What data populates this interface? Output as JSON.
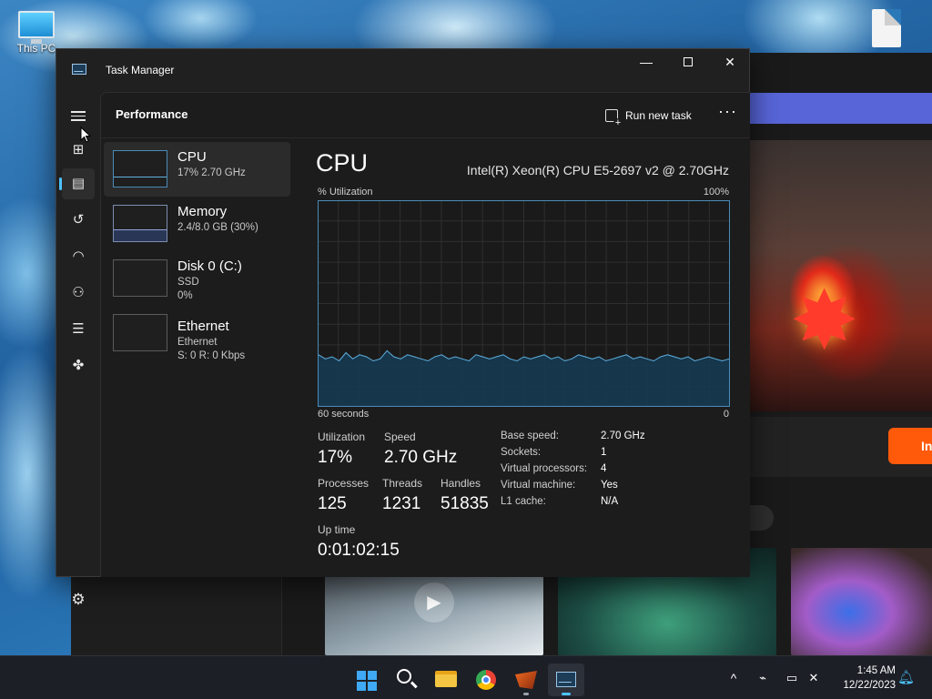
{
  "desktop": {
    "icons": [
      {
        "label": "This PC"
      }
    ]
  },
  "background_app": {
    "button_label_partial": "In",
    "pill_label_partial": "s"
  },
  "window": {
    "title": "Task Manager",
    "controls": {
      "minimize": "—",
      "close": "✕"
    }
  },
  "nav": {
    "items": [
      "Processes",
      "Performance",
      "App history",
      "Startup apps",
      "Users",
      "Details",
      "Services"
    ],
    "active": "Performance",
    "settings_label": "Settings"
  },
  "header": {
    "title": "Performance",
    "run_new_task": "Run new task",
    "more": "···"
  },
  "devices": [
    {
      "name": "CPU",
      "line1": "17%  2.70 GHz",
      "line2": ""
    },
    {
      "name": "Memory",
      "line1": "2.4/8.0 GB (30%)",
      "line2": ""
    },
    {
      "name": "Disk 0 (C:)",
      "line1": "SSD",
      "line2": "0%"
    },
    {
      "name": "Ethernet",
      "line1": "Ethernet",
      "line2": "S: 0  R: 0 Kbps"
    }
  ],
  "cpu_panel": {
    "title": "CPU",
    "model": "Intel(R) Xeon(R) CPU E5-2697 v2 @ 2.70GHz",
    "graph_label_left": "% Utilization",
    "graph_label_right": "100%",
    "time_label_left": "60 seconds",
    "time_label_right": "0",
    "stats": {
      "utilization": {
        "label": "Utilization",
        "value": "17%"
      },
      "speed": {
        "label": "Speed",
        "value": "2.70 GHz"
      },
      "processes": {
        "label": "Processes",
        "value": "125"
      },
      "threads": {
        "label": "Threads",
        "value": "1231"
      },
      "handles": {
        "label": "Handles",
        "value": "51835"
      },
      "uptime": {
        "label": "Up time",
        "value": "0:01:02:15"
      }
    },
    "properties": [
      {
        "key": "Base speed:",
        "value": "2.70 GHz"
      },
      {
        "key": "Sockets:",
        "value": "1"
      },
      {
        "key": "Virtual processors:",
        "value": "4"
      },
      {
        "key": "Virtual machine:",
        "value": "Yes"
      },
      {
        "key": "L1 cache:",
        "value": "N/A"
      }
    ],
    "graph_series": [
      25,
      23,
      24,
      22,
      26,
      23,
      25,
      24,
      22,
      23,
      27,
      24,
      23,
      25,
      24,
      23,
      22,
      24,
      25,
      23,
      24,
      23,
      22,
      25,
      24,
      23,
      24,
      25,
      23,
      22,
      24,
      23,
      24,
      25,
      23,
      24,
      22,
      23,
      25,
      24,
      23,
      24,
      22,
      23,
      24,
      25,
      23,
      24,
      23,
      22,
      24,
      25,
      24,
      23,
      24,
      22,
      23,
      24,
      23,
      22,
      23
    ],
    "graph_color": "#5fb0e0"
  },
  "taskbar": {
    "apps": [
      "Start",
      "Search",
      "File Explorer",
      "Google Chrome",
      "Game Launcher",
      "Task Manager"
    ],
    "time": "1:45 AM",
    "date": "12/22/2023",
    "tray_chevron": "^"
  }
}
